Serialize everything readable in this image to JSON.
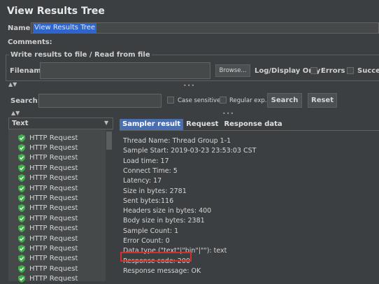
{
  "window": {
    "title": "View Results Tree"
  },
  "name_field": {
    "label": "Name:",
    "value": "View Results Tree"
  },
  "comments": {
    "label": "Comments:"
  },
  "file_group": {
    "title": "Write results to file / Read from file",
    "filename_label": "Filename",
    "browse_label": "Browse...",
    "log_display_label": "Log/Display Only:",
    "errors_label": "Errors",
    "successes_label": "Succes"
  },
  "search": {
    "label": "Search:",
    "case_sensitive_label": "Case sensitive",
    "regex_label": "Regular exp.",
    "search_button": "Search",
    "reset_button": "Reset"
  },
  "tree": {
    "header": "Text",
    "items": [
      {
        "label": "HTTP Request"
      },
      {
        "label": "HTTP Request"
      },
      {
        "label": "HTTP Request"
      },
      {
        "label": "HTTP Request"
      },
      {
        "label": "HTTP Request"
      },
      {
        "label": "HTTP Request"
      },
      {
        "label": "HTTP Request"
      },
      {
        "label": "HTTP Request"
      },
      {
        "label": "HTTP Request"
      },
      {
        "label": "HTTP Request"
      },
      {
        "label": "HTTP Request"
      },
      {
        "label": "HTTP Request"
      },
      {
        "label": "HTTP Request"
      },
      {
        "label": "HTTP Request"
      },
      {
        "label": "HTTP Request"
      }
    ],
    "status_icon": "green-shield-check-icon"
  },
  "tabs": [
    {
      "label": "Sampler result",
      "active": true
    },
    {
      "label": "Request",
      "active": false
    },
    {
      "label": "Response data",
      "active": false
    }
  ],
  "sampler_result": [
    "Thread Name: Thread Group 1-1",
    "Sample Start: 2019-03-23 23:53:03 CST",
    "Load time: 17",
    "Connect Time: 5",
    "Latency: 17",
    "Size in bytes: 2781",
    "Sent bytes:116",
    "Headers size in bytes: 400",
    "Body size in bytes: 2381",
    "Sample Count: 1",
    "Error Count: 0",
    "Data type (\"text\"|\"bin\"|\"\"): text",
    "Response code: 200",
    "Response message: OK"
  ],
  "colors": {
    "background": "#3c3f41",
    "accent": "#4b6eaf",
    "highlight_border": "#d03030",
    "success_icon": "#3fae49"
  }
}
